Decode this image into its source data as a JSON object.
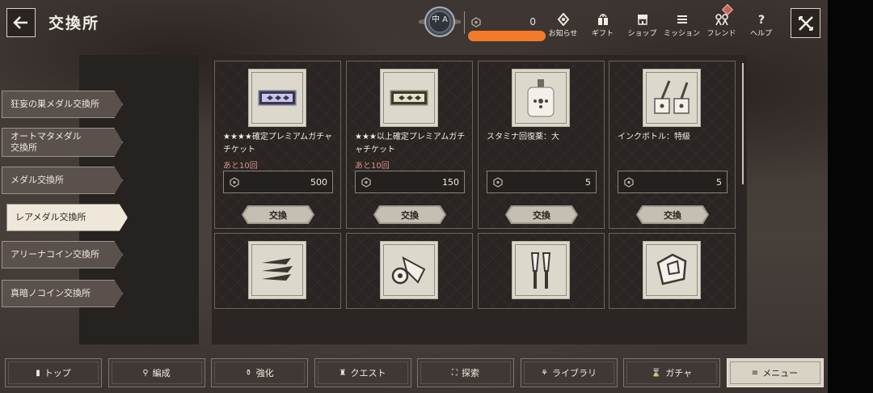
{
  "header": {
    "title": "交換所",
    "rank_label": "中 A",
    "currency_value": "0"
  },
  "top_nav": [
    {
      "label": "お知らせ",
      "icon": "notice-icon"
    },
    {
      "label": "ギフト",
      "icon": "gift-icon"
    },
    {
      "label": "ショップ",
      "icon": "shop-icon"
    },
    {
      "label": "ミッション",
      "icon": "mission-icon"
    },
    {
      "label": "フレンド",
      "icon": "friend-icon"
    },
    {
      "label": "ヘルプ",
      "icon": "help-icon"
    }
  ],
  "tabs": [
    {
      "label": "狂妄の巣メダル交換所"
    },
    {
      "label": "オートマタメダル\n交換所"
    },
    {
      "label": "メダル交換所"
    },
    {
      "label": "レアメダル交換所",
      "active": true
    },
    {
      "label": "アリーナコイン交換所"
    },
    {
      "label": "真暗ノコイン交換所"
    }
  ],
  "items": [
    {
      "name": "★★★★確定プレミアムガチャチケット",
      "limit": "あと10回",
      "price": "500",
      "button": "交換"
    },
    {
      "name": "★★★以上確定プレミアムガチャチケット",
      "limit": "あと10回",
      "price": "150",
      "button": "交換"
    },
    {
      "name": "スタミナ回復薬：大",
      "limit": "",
      "price": "5",
      "button": "交換"
    },
    {
      "name": "インクボトル：特級",
      "limit": "",
      "price": "5",
      "button": "交換"
    }
  ],
  "bottom_nav": [
    {
      "label": "トップ"
    },
    {
      "label": "編成"
    },
    {
      "label": "強化"
    },
    {
      "label": "クエスト"
    },
    {
      "label": "探索"
    },
    {
      "label": "ライブラリ"
    },
    {
      "label": "ガチャ"
    },
    {
      "label": "メニュー",
      "active": true
    }
  ],
  "colors": {
    "accent_limit": "#d98f88",
    "active_tab": "#efe8da",
    "redaction": "#f37a28"
  }
}
